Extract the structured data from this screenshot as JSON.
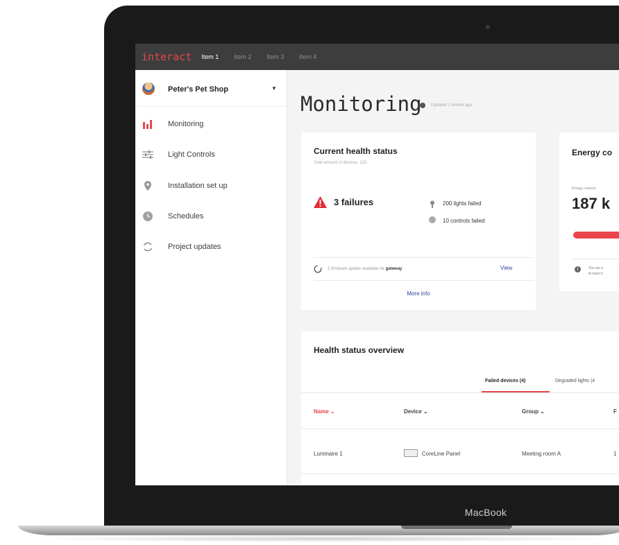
{
  "device": {
    "brand": "MacBook"
  },
  "app": {
    "logo": "interact",
    "nav": [
      "Item 1",
      "Item 2",
      "Item 3",
      "Item 4"
    ]
  },
  "sidebar": {
    "shop_name": "Peter's Pet Shop",
    "items": [
      {
        "label": "Monitoring",
        "icon": "bar-chart-icon"
      },
      {
        "label": "Light Controls",
        "icon": "sliders-icon"
      },
      {
        "label": "Installation set up",
        "icon": "location-pin-icon"
      },
      {
        "label": "Schedules",
        "icon": "clock-icon"
      },
      {
        "label": "Project updates",
        "icon": "refresh-icon"
      }
    ]
  },
  "page": {
    "title": "Monitoring",
    "updated": "Updated 1 minute ago"
  },
  "health_card": {
    "title": "Current health status",
    "subtitle": "Total amount of devices: 123",
    "failures": "3 failures",
    "lights_failed": "200 lights failed",
    "controls_failed": "10 controls failed",
    "firmware_text": "1 firmware update available for",
    "firmware_target": "gateway",
    "view": "View",
    "more_info": "More info"
  },
  "energy_card": {
    "title": "Energy co",
    "label": "Energy consum",
    "value": "187 k",
    "info_line1": "You are u",
    "info_line2": "to learn h"
  },
  "overview": {
    "title": "Health status overview",
    "tabs": [
      "Failed devices (4)",
      "Degraded lights (4"
    ],
    "columns": [
      "Name",
      "Device",
      "Group",
      "F"
    ],
    "rows": [
      {
        "name": "Luminaire 1",
        "device": "CoreLine Panel",
        "group": "Meeting room A",
        "extra": "1"
      }
    ]
  },
  "colors": {
    "accent": "#e8464b",
    "link": "#2c3ea0",
    "topbar": "#3d3d3d"
  }
}
